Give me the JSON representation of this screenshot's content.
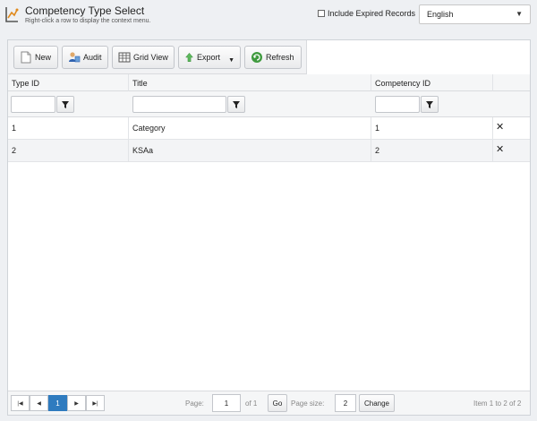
{
  "header": {
    "title": "Competency Type Select",
    "subtitle": "Right-click a row to display the context menu.",
    "expired_label": "Include Expired Records",
    "language": "English"
  },
  "toolbar": {
    "new_label": "New",
    "audit_label": "Audit",
    "gridview_label": "Grid View",
    "export_label": "Export",
    "refresh_label": "Refresh"
  },
  "columns": [
    "Type ID",
    "Title",
    "Competency ID"
  ],
  "rows": [
    {
      "type_id": "1",
      "title": "Category",
      "competency_id": "1"
    },
    {
      "type_id": "2",
      "title": "KSAa",
      "competency_id": "2"
    }
  ],
  "pager": {
    "current_page": "1",
    "page_label": "Page:",
    "page_value": "1",
    "of_label": "of 1",
    "go_label": "Go",
    "size_label": "Page size:",
    "size_value": "2",
    "change_label": "Change",
    "summary": "Item 1 to 2 of 2"
  },
  "colors": {
    "accent": "#2f7bbf",
    "delete": "#222222"
  }
}
